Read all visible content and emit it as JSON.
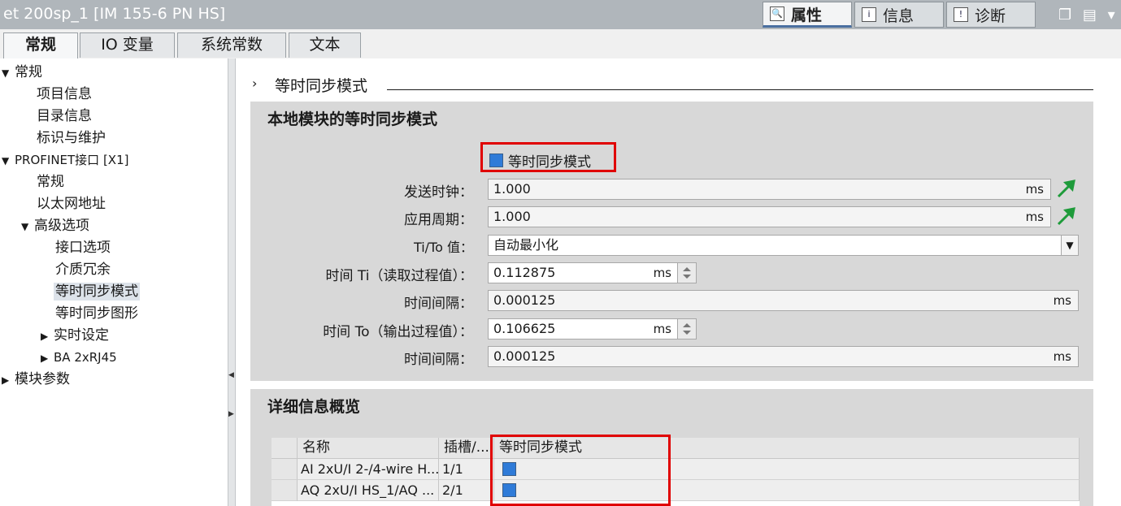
{
  "window": {
    "title": "et 200sp_1 [IM 155-6 PN HS]",
    "panel_tabs": [
      {
        "label": "属性",
        "icon": "properties-icon"
      },
      {
        "label": "信息",
        "icon": "info-icon"
      },
      {
        "label": "诊断",
        "icon": "diagnostics-icon"
      }
    ],
    "controls": "❐ ▤ ▾"
  },
  "sub_tabs": [
    "常规",
    "IO 变量",
    "系统常数",
    "文本"
  ],
  "tree": {
    "items": [
      {
        "label": "常规",
        "expander": "▼"
      },
      {
        "label": "项目信息",
        "expander": ""
      },
      {
        "label": "目录信息",
        "expander": ""
      },
      {
        "label": "标识与维护",
        "expander": ""
      },
      {
        "label": "PROFINET接口 [X1]",
        "expander": "▼"
      },
      {
        "label": "常规",
        "expander": ""
      },
      {
        "label": "以太网地址",
        "expander": ""
      },
      {
        "label": "高级选项",
        "expander": "▼"
      },
      {
        "label": "接口选项",
        "expander": ""
      },
      {
        "label": "介质冗余",
        "expander": ""
      },
      {
        "label": "等时同步模式",
        "expander": ""
      },
      {
        "label": "等时同步图形",
        "expander": ""
      },
      {
        "label": "实时设定",
        "expander": "▶"
      },
      {
        "label": "BA 2xRJ45",
        "expander": "▶"
      },
      {
        "label": "模块参数",
        "expander": "▶"
      }
    ]
  },
  "content": {
    "section_arrow": "›",
    "section_title": "等时同步模式",
    "local": {
      "title": "本地模块的等时同步模式",
      "checkbox_label": "等时同步模式",
      "send_clock": {
        "label": "发送时钟：",
        "value": "1.000",
        "unit": "ms"
      },
      "app_cycle": {
        "label": "应用周期：",
        "value": "1.000",
        "unit": "ms"
      },
      "tito": {
        "label": "Ti/To 值：",
        "value": "自动最小化"
      },
      "ti": {
        "label": "时间 Ti（读取过程值）：",
        "value": "0.112875",
        "unit": "ms"
      },
      "ti_interval": {
        "label": "时间间隔：",
        "value": "0.000125",
        "unit": "ms"
      },
      "to": {
        "label": "时间 To（输出过程值）：",
        "value": "0.106625",
        "unit": "ms"
      },
      "to_interval": {
        "label": "时间间隔：",
        "value": "0.000125",
        "unit": "ms"
      }
    },
    "overview": {
      "title": "详细信息概览",
      "columns": [
        "名称",
        "插槽/...",
        "等时同步模式"
      ],
      "rows": [
        {
          "name": "AI 2xU/I 2-/4-wire H...",
          "slot": "1/1",
          "iso": true
        },
        {
          "name": "AQ 2xU/I HS_1/AQ ...",
          "slot": "2/1",
          "iso": true
        }
      ]
    }
  },
  "colors": {
    "accent": "#2f7bd8",
    "highlight": "#e00000",
    "green_arrow": "#1e9b3a"
  }
}
